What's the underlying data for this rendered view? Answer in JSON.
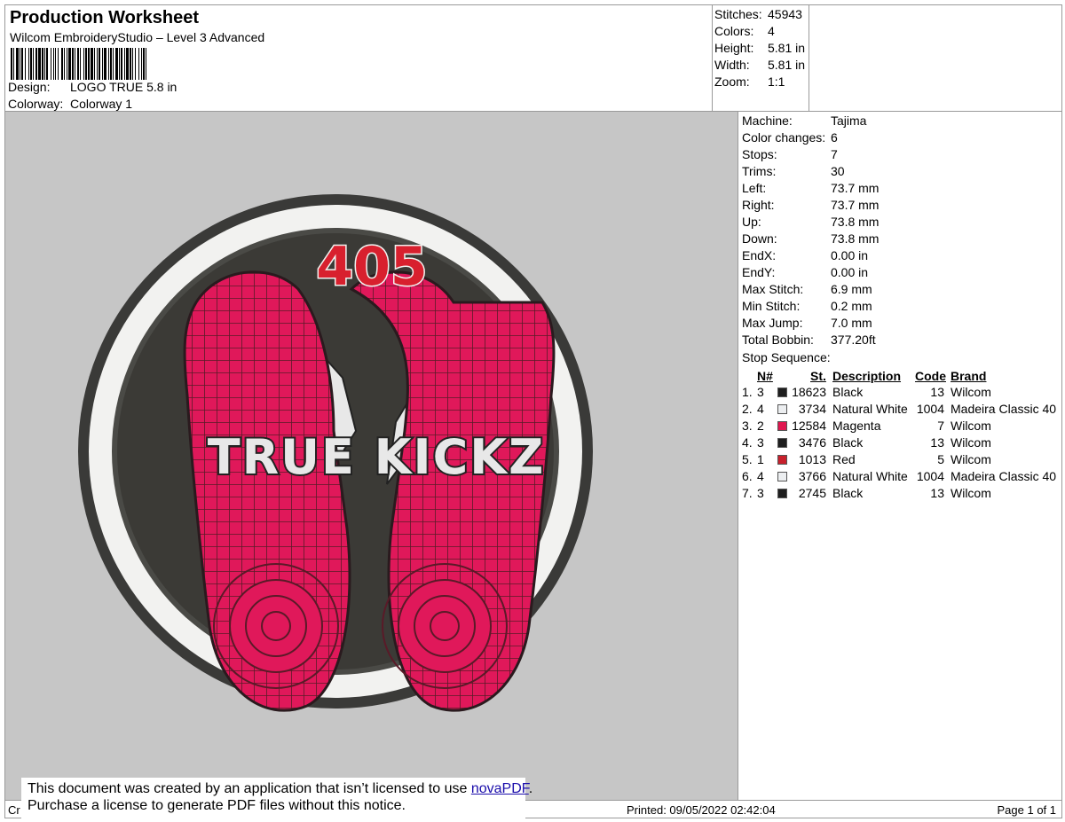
{
  "header": {
    "title": "Production Worksheet",
    "subtitle": "Wilcom EmbroideryStudio – Level 3 Advanced",
    "design_label": "Design:",
    "design_value": "LOGO TRUE 5.8 in",
    "colorway_label": "Colorway:",
    "colorway_value": "Colorway 1"
  },
  "stats": [
    {
      "label": "Stitches:",
      "value": "45943"
    },
    {
      "label": "Colors:",
      "value": "4"
    },
    {
      "label": "Height:",
      "value": "5.81 in"
    },
    {
      "label": "Width:",
      "value": "5.81 in"
    },
    {
      "label": "Zoom:",
      "value": "1:1"
    }
  ],
  "machine": [
    {
      "label": "Machine:",
      "value": "Tajima"
    },
    {
      "label": "Color changes:",
      "value": "6"
    },
    {
      "label": "Stops:",
      "value": "7"
    },
    {
      "label": "Trims:",
      "value": "30"
    },
    {
      "label": "Left:",
      "value": "73.7 mm"
    },
    {
      "label": "Right:",
      "value": "73.7 mm"
    },
    {
      "label": "Up:",
      "value": "73.8 mm"
    },
    {
      "label": "Down:",
      "value": "73.8 mm"
    },
    {
      "label": "EndX:",
      "value": "0.00 in"
    },
    {
      "label": "EndY:",
      "value": "0.00 in"
    },
    {
      "label": "Max Stitch:",
      "value": "6.9 mm"
    },
    {
      "label": "Min Stitch:",
      "value": "0.2 mm"
    },
    {
      "label": "Max Jump:",
      "value": "7.0 mm"
    },
    {
      "label": "Total Bobbin:",
      "value": "377.20ft"
    }
  ],
  "sequence": {
    "title": "Stop Sequence:",
    "headers": {
      "n": "N#",
      "st": "St.",
      "desc": "Description",
      "code": "Code",
      "brand": "Brand"
    },
    "rows": [
      {
        "idx": "1.",
        "n": "3",
        "color": "#1e1e1e",
        "st": "18623",
        "desc": "Black",
        "code": "13",
        "brand": "Wilcom"
      },
      {
        "idx": "2.",
        "n": "4",
        "color": "#eceef0",
        "st": "3734",
        "desc": "Natural White",
        "code": "1004",
        "brand": "Madeira Classic 40"
      },
      {
        "idx": "3.",
        "n": "2",
        "color": "#e0164f",
        "st": "12584",
        "desc": "Magenta",
        "code": "7",
        "brand": "Wilcom"
      },
      {
        "idx": "4.",
        "n": "3",
        "color": "#1e1e1e",
        "st": "3476",
        "desc": "Black",
        "code": "13",
        "brand": "Wilcom"
      },
      {
        "idx": "5.",
        "n": "1",
        "color": "#c8202c",
        "st": "1013",
        "desc": "Red",
        "code": "5",
        "brand": "Wilcom"
      },
      {
        "idx": "6.",
        "n": "4",
        "color": "#eceef0",
        "st": "3766",
        "desc": "Natural White",
        "code": "1004",
        "brand": "Madeira Classic 40"
      },
      {
        "idx": "7.",
        "n": "3",
        "color": "#1e1e1e",
        "st": "2745",
        "desc": "Black",
        "code": "13",
        "brand": "Wilcom"
      }
    ]
  },
  "design": {
    "number_text": "405",
    "brand_text": "TRUE KICKZ",
    "colors": {
      "background": "#c6c6c6",
      "ring": "#f2f2f0",
      "outer_border": "#3a3a3a",
      "inner": "#3b3a36",
      "sole": "#e0185a",
      "number": "#d8202e"
    }
  },
  "footer": {
    "left": "Cr",
    "printed": "Printed: 09/05/2022 02:42:04",
    "page": "Page 1 of 1"
  },
  "notice": {
    "line1_prefix": "This document was created by an application that isn’t licensed to use ",
    "line1_link": "novaPDF",
    "line1_suffix": ".",
    "line2": "Purchase a license to generate PDF files without this notice."
  }
}
